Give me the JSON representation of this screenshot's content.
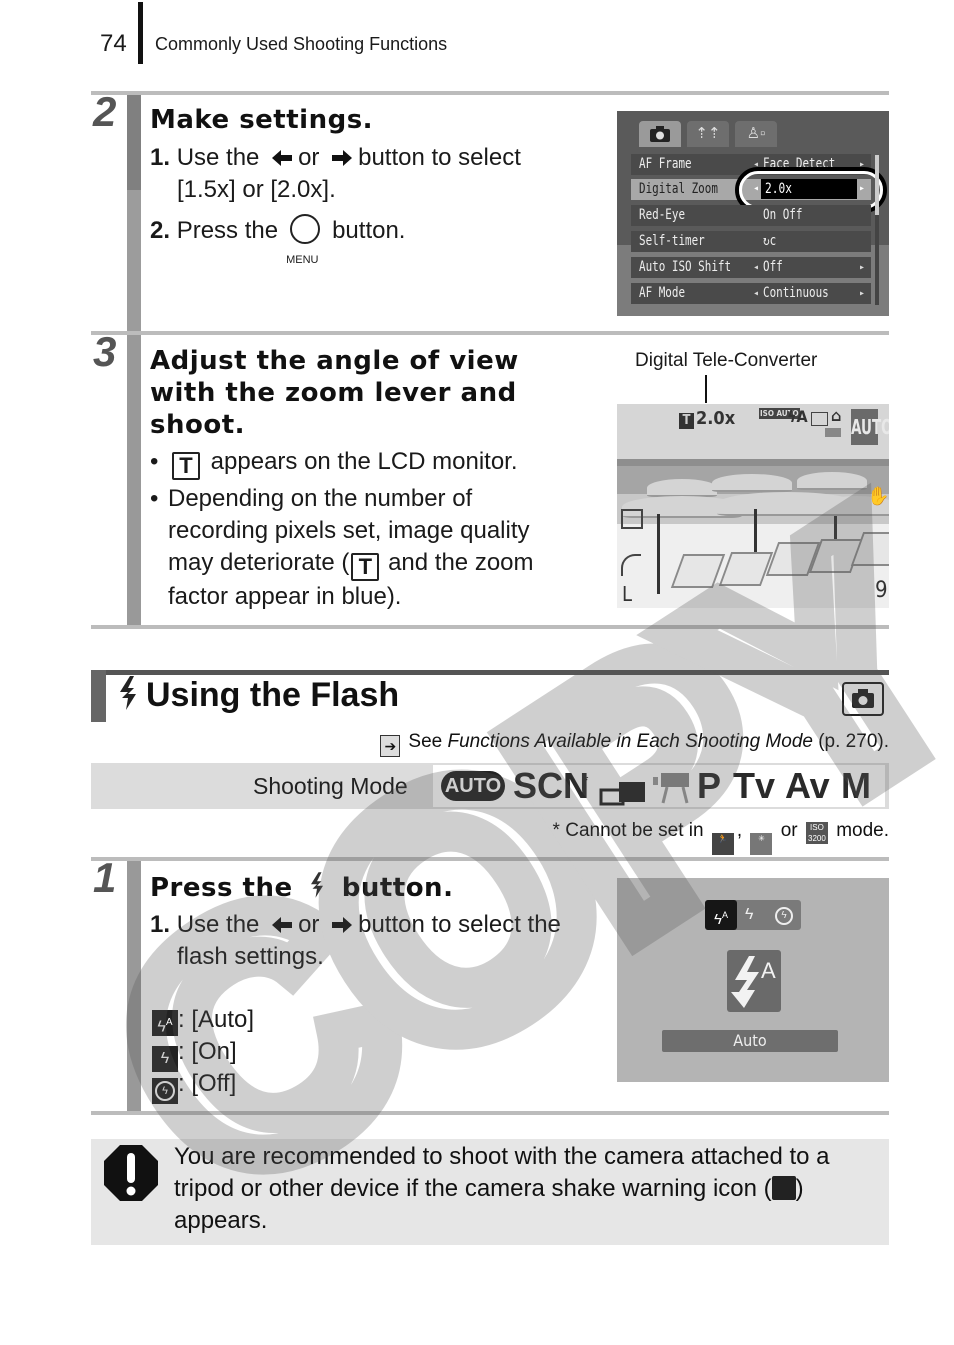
{
  "header": {
    "page_number": "74",
    "chapter_title": "Commonly Used Shooting Functions"
  },
  "step2": {
    "number": "2",
    "title": "Make settings.",
    "items": [
      {
        "num": "1.",
        "pre": "Use the",
        "mid": "or",
        "post": "button to select",
        "line2": "[1.5x] or [2.0x]."
      },
      {
        "num": "2.",
        "pre": "Press the",
        "post": "button.",
        "button_label": "MENU"
      }
    ],
    "lcd": {
      "tabs": [
        "camera-tab",
        "settings-tab",
        "my-menu-tab"
      ],
      "rows": [
        {
          "key": "AF Frame",
          "value": "Face Detect"
        },
        {
          "key": "Digital Zoom",
          "value": "2.0x",
          "selected": true
        },
        {
          "key": "Red-Eye",
          "value": "On  Off"
        },
        {
          "key": "Self-timer",
          "value": "↻c"
        },
        {
          "key": "Auto ISO Shift",
          "value": "Off"
        },
        {
          "key": "AF Mode",
          "value": "Continuous"
        }
      ]
    }
  },
  "step3": {
    "number": "3",
    "title_lines": [
      "Adjust the angle of view",
      "with the zoom lever and",
      "shoot."
    ],
    "bullet1_post": "appears on the LCD monitor.",
    "bullet2_lines": [
      "Depending on the number of",
      "recording pixels set, image quality"
    ],
    "bullet2_line3_pre": "may deteriorate (",
    "bullet2_line3_post": "and the zoom",
    "bullet2_line4": "factor appear in blue).",
    "t_icon_label": "T",
    "caption": "Digital Tele-Converter",
    "osd": {
      "zoom": "2.0x",
      "mode": "AUTO",
      "shots": "9",
      "size": "L",
      "iso": "ISO AUTO"
    }
  },
  "section": {
    "title": "Using the Flash",
    "see_pre": "See",
    "see_italic": "Functions Available in Each Shooting Mode",
    "see_post": "(p. 270).",
    "shooting_mode_label": "Shooting Mode",
    "modes": [
      "AUTO",
      "SCN",
      "*",
      "P",
      "Tv",
      "Av",
      "M"
    ],
    "footnote_pre": "* Cannot be set in",
    "footnote_sep": ",",
    "footnote_or": "or",
    "footnote_post": "mode."
  },
  "step1": {
    "number": "1",
    "title_pre": "Press the",
    "title_post": "button.",
    "item_num": "1.",
    "item_pre": "Use the",
    "item_mid": "or",
    "item_post": "button to select the",
    "item_line2": "flash settings.",
    "flash_modes": [
      {
        "label": ": [Auto]"
      },
      {
        "label": ": [On]"
      },
      {
        "label": ": [Off]"
      }
    ],
    "lcd_label": "Auto"
  },
  "caution": {
    "line1": "You are recommended to shoot with the camera attached to a",
    "line2_pre": "tripod or other device if the camera shake warning icon (",
    "line2_post": ")",
    "line3": "appears."
  },
  "watermark": "COPY"
}
